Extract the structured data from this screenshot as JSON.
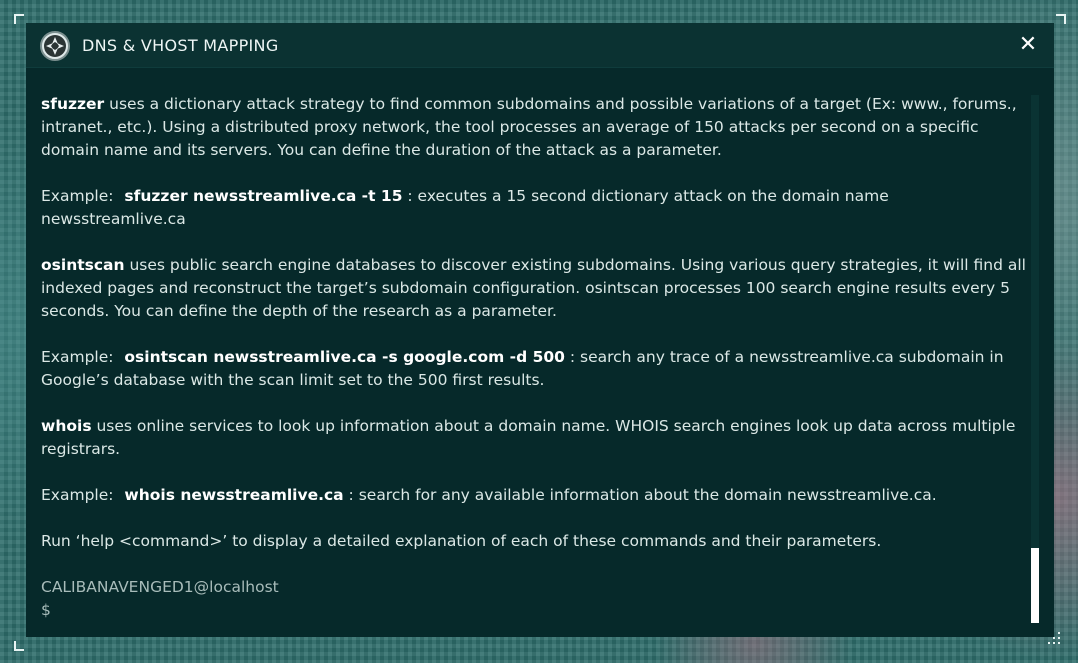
{
  "window": {
    "title": "DNS & VHOST MAPPING",
    "close_label": "✕"
  },
  "content": {
    "sfuzzer": {
      "cmd": "sfuzzer",
      "desc": " uses a dictionary attack strategy to find common subdomains and possible variations of a target (Ex: www., forums., intranet., etc.). Using a distributed proxy network, the tool processes an average of 150 attacks per second on a specific domain name and its servers. You can define the duration of the attack as a parameter.",
      "example_label": "Example:",
      "example_cmd": "sfuzzer newsstreamlive.ca -t 15",
      "example_desc": " : executes a 15 second dictionary attack on the domain name newsstreamlive.ca"
    },
    "osintscan": {
      "cmd": "osintscan",
      "desc": " uses public search engine databases to discover existing subdomains. Using various query strategies, it will find all indexed pages and reconstruct the target’s subdomain configuration. osintscan processes 100 search engine results every 5 seconds. You can define the depth of the research as a parameter.",
      "example_label": "Example:",
      "example_cmd": "osintscan newsstreamlive.ca -s google.com -d 500",
      "example_desc": " : search any trace of a newsstreamlive.ca subdomain in Google’s database with the scan limit set to the 500 first results."
    },
    "whois": {
      "cmd": "whois",
      "desc": " uses online services to look up information about a domain name. WHOIS search engines look up data across multiple registrars.",
      "example_label": "Example:",
      "example_cmd": "whois newsstreamlive.ca",
      "example_desc": " : search for any available information about the domain newsstreamlive.ca."
    },
    "help_hint": "Run ‘help <command>’ to display a detailed explanation of each of these commands and their parameters.",
    "prompt_user": "CALIBANAVENGED1@localhost",
    "prompt_symbol": "$"
  }
}
